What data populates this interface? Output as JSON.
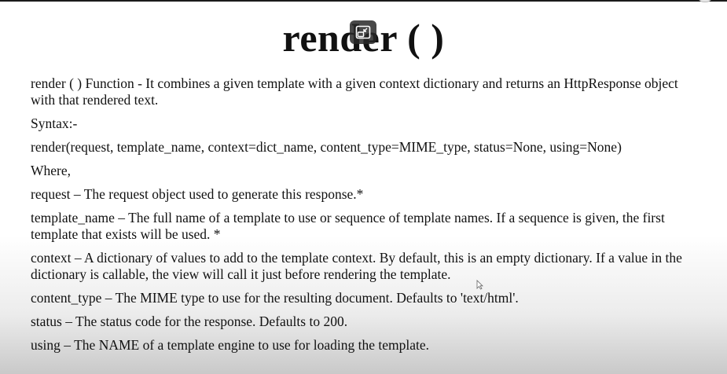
{
  "title": "render ( )",
  "overlay": {
    "icon": "pip-exit-icon"
  },
  "paragraphs": [
    "render ( ) Function - It combines a given template with a given context dictionary and returns an HttpResponse object with that rendered text.",
    "Syntax:-",
    "render(request, template_name, context=dict_name, content_type=MIME_type, status=None, using=None)",
    "Where,",
    "request – The request object used to generate this response.*",
    "template_name – The full name of a template to use or sequence of template names. If a sequence is given, the first template that exists will be used. *",
    "context – A dictionary of values to add to the template context. By default, this is an empty dictionary. If a value in the dictionary is callable, the view will call it just before rendering the template.",
    "content_type – The MIME type to use for the resulting document. Defaults to 'text/html'.",
    "status – The status code for the response. Defaults to 200.",
    "using – The NAME of a template engine to use for loading the template."
  ]
}
